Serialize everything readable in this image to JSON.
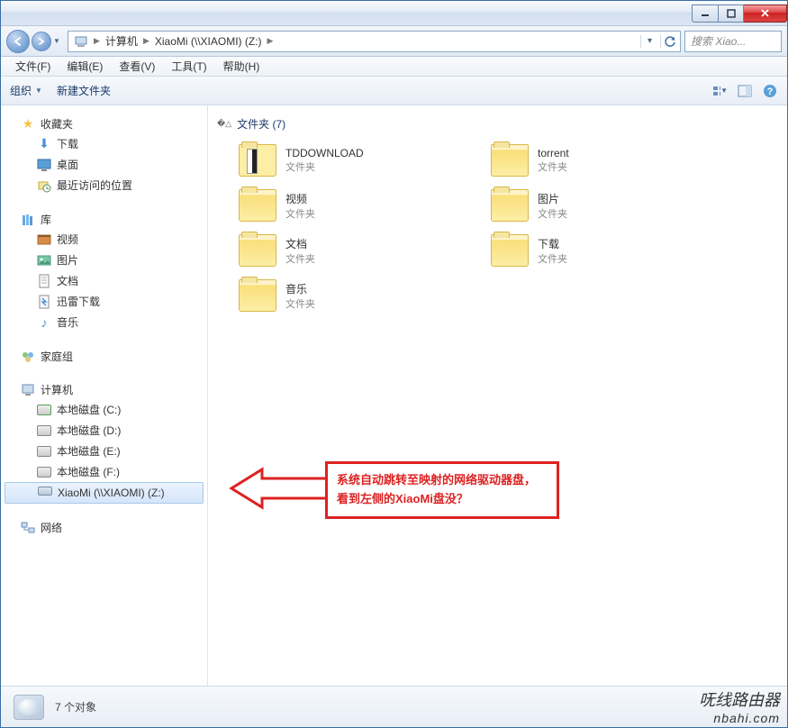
{
  "breadcrumb": {
    "root": "计算机",
    "path": "XiaoMi (\\\\XIAOMI) (Z:)"
  },
  "search": {
    "placeholder": "搜索 Xiao..."
  },
  "menu": {
    "file": "文件(F)",
    "edit": "编辑(E)",
    "view": "查看(V)",
    "tools": "工具(T)",
    "help": "帮助(H)"
  },
  "toolbar": {
    "organize": "组织",
    "newfolder": "新建文件夹"
  },
  "sidebar": {
    "favorites": {
      "label": "收藏夹",
      "items": [
        {
          "icon": "download-icon",
          "label": "下载"
        },
        {
          "icon": "desktop-icon",
          "label": "桌面"
        },
        {
          "icon": "recent-icon",
          "label": "最近访问的位置"
        }
      ]
    },
    "libraries": {
      "label": "库",
      "items": [
        {
          "icon": "video-lib-icon",
          "label": "视频"
        },
        {
          "icon": "pictures-lib-icon",
          "label": "图片"
        },
        {
          "icon": "documents-lib-icon",
          "label": "文档"
        },
        {
          "icon": "xunlei-icon",
          "label": "迅雷下载"
        },
        {
          "icon": "music-lib-icon",
          "label": "音乐"
        }
      ]
    },
    "homegroup": {
      "label": "家庭组"
    },
    "computer": {
      "label": "计算机",
      "items": [
        {
          "icon": "hdd-icon",
          "label": "本地磁盘 (C:)"
        },
        {
          "icon": "hdd-icon",
          "label": "本地磁盘 (D:)"
        },
        {
          "icon": "hdd-icon",
          "label": "本地磁盘 (E:)"
        },
        {
          "icon": "hdd-icon",
          "label": "本地磁盘 (F:)"
        },
        {
          "icon": "netdrive-icon",
          "label": "XiaoMi (\\\\XIAOMI) (Z:)",
          "selected": true
        }
      ]
    },
    "network": {
      "label": "网络"
    }
  },
  "content": {
    "group_header": "文件夹 (7)",
    "type_label": "文件夹",
    "folders": [
      {
        "name": "TDDOWNLOAD",
        "special": "td"
      },
      {
        "name": "torrent"
      },
      {
        "name": "视频"
      },
      {
        "name": "图片"
      },
      {
        "name": "文档"
      },
      {
        "name": "下载"
      },
      {
        "name": "音乐"
      }
    ]
  },
  "annotation": {
    "line1": "系统自动跳转至映射的网络驱动器盘，",
    "line2": "看到左侧的XiaoMi盘没？"
  },
  "status": {
    "count": "7 个对象"
  },
  "watermark": {
    "line1": "呒线路由器",
    "line2": "nbahi.com"
  }
}
